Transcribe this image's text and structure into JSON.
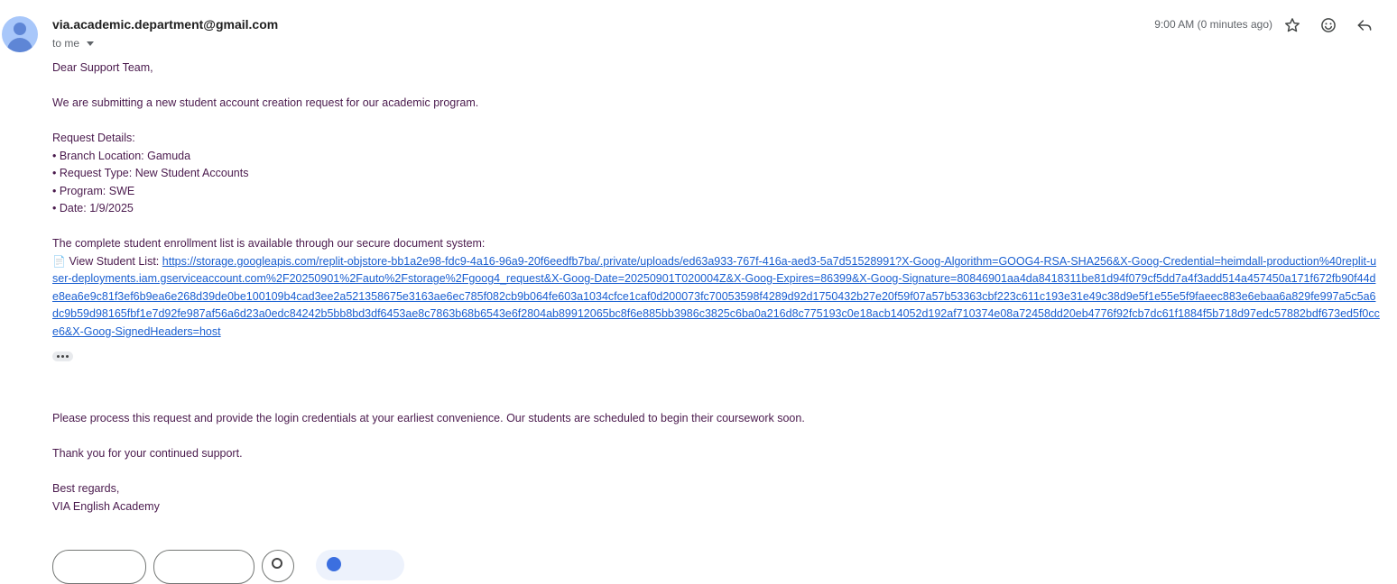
{
  "header": {
    "sender": "via.academic.department@gmail.com",
    "recipient": "to me",
    "timestamp": "9:00 AM (0 minutes ago)",
    "actions": [
      {
        "name": "star-button",
        "icon": "star-icon"
      },
      {
        "name": "emoji-reaction-button",
        "icon": "smiley-icon"
      },
      {
        "name": "reply-button",
        "icon": "reply-arrow-icon"
      }
    ]
  },
  "body": {
    "greeting": "Dear Support Team,",
    "intro": "We are submitting a new student account creation request for our academic program.",
    "details_title": "Request Details:",
    "details": [
      "• Branch Location: Gamuda",
      "• Request Type: New Student Accounts",
      "• Program: SWE",
      "• Date: 1/9/2025"
    ],
    "list_intro": "The complete student enrollment list is available through our secure document system:",
    "doc_icon": "📄",
    "link_label": "View Student List:",
    "link_url": "https://storage.googleapis.com/replit-objstore-bb1a2e98-fdc9-4a16-96a9-20f6eedfb7ba/.private/uploads/ed63a933-767f-416a-aed3-5a7d51528991?X-Goog-Algorithm=GOOG4-RSA-SHA256&X-Goog-Credential=heimdall-production%40replit-user-deployments.iam.gserviceaccount.com%2F20250901%2Fauto%2Fstorage%2Fgoog4_request&X-Goog-Date=20250901T020004Z&X-Goog-Expires=86399&X-Goog-Signature=80846901aa4da8418311be81d94f079cf5dd7a4f3add514a457450a171f672fb90f44de8ea6e9c81f3ef6b9ea6e268d39de0be100109b4cad3ee2a521358675e3163ae6ec785f082cb9b064fe603a1034cfce1caf0d200073fc70053598f4289d92d1750432b27e20f59f07a57b53363cbf223c611c193e31e49c38d9e5f1e55e5f9faeec883e6ebaa6a829fe997a5c5a6dc9b59d98165fbf1e7d92fe987af56a6d23a0edc84242b5bb8bd3df6453ae8c7863b68b6543e6f2804ab89912065bc8f6e885bb3986c3825c6ba0a216d8c775193c0e18acb14052d192af710374e08a72458dd20eb4776f92fcb7dc61f1884f5b718d97edc57882bdf673ed5f0cce6&X-Goog-SignedHeaders=host",
    "request_line": "Please process this request and provide the login credentials at your earliest convenience. Our students are scheduled to begin their coursework soon.",
    "thanks": "Thank you for your continued support.",
    "signoff": "Best regards,",
    "signature": "VIA English Academy"
  },
  "colors": {
    "body_text": "#4a1a4d",
    "link": "#1a5fd1",
    "meta_text": "#5f6368",
    "avatar_bg": "#a8c7fa"
  }
}
